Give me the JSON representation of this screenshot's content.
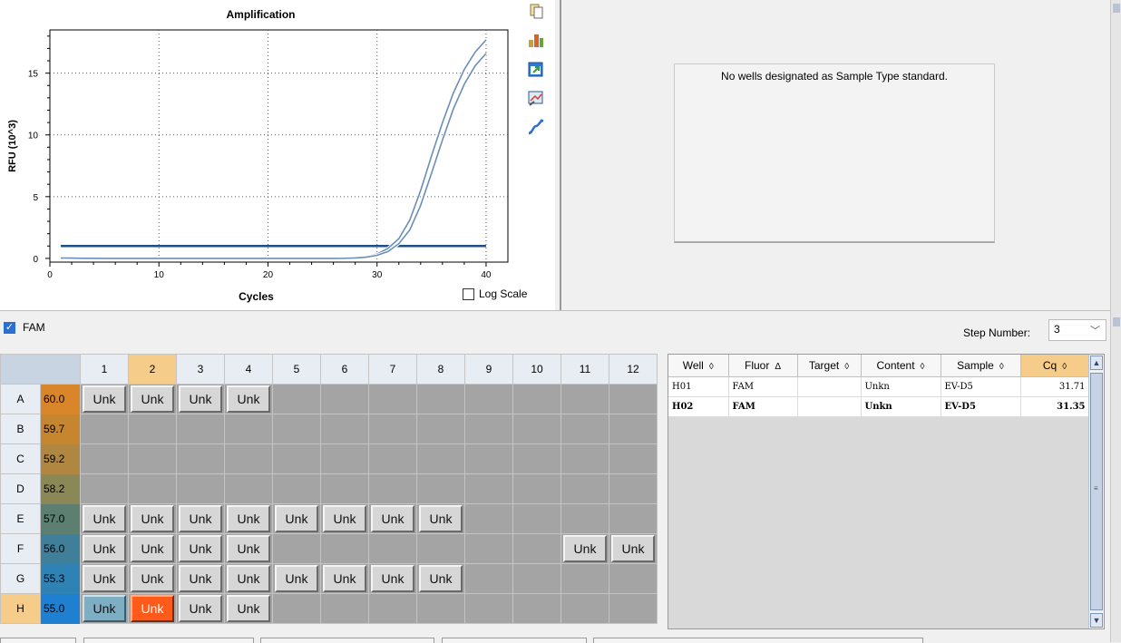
{
  "chart_data": {
    "type": "line",
    "title": "Amplification",
    "xlabel": "Cycles",
    "ylabel": "RFU (10^3)",
    "xlim": [
      0,
      42
    ],
    "ylim": [
      -0.3,
      18.5
    ],
    "xticks": [
      0,
      10,
      20,
      30,
      40
    ],
    "yticks": [
      0,
      5,
      10,
      15
    ],
    "grid": true,
    "series": [
      {
        "x": [
          1,
          2,
          3,
          4,
          5,
          6,
          7,
          8,
          9,
          10,
          11,
          12,
          13,
          14,
          15,
          16,
          17,
          18,
          19,
          20,
          21,
          22,
          23,
          24,
          25,
          26,
          27,
          28,
          29,
          30,
          31,
          32,
          33,
          34,
          35,
          36,
          37,
          38,
          39,
          40
        ],
        "values": [
          0.05,
          0.04,
          0.02,
          0.02,
          0.01,
          0.0,
          0.0,
          0.0,
          0.0,
          0.0,
          0.0,
          0.0,
          0.0,
          0.0,
          0.0,
          0.0,
          0.0,
          0.0,
          0.0,
          0.0,
          0.0,
          0.0,
          0.0,
          0.0,
          0.0,
          0.0,
          0.02,
          0.06,
          0.15,
          0.35,
          0.8,
          1.6,
          3.1,
          5.5,
          8.3,
          11.0,
          13.4,
          15.3,
          16.7,
          17.7
        ],
        "color": "#6a8eb8"
      },
      {
        "x": [
          1,
          2,
          3,
          4,
          5,
          6,
          7,
          8,
          9,
          10,
          11,
          12,
          13,
          14,
          15,
          16,
          17,
          18,
          19,
          20,
          21,
          22,
          23,
          24,
          25,
          26,
          27,
          28,
          29,
          30,
          31,
          32,
          33,
          34,
          35,
          36,
          37,
          38,
          39,
          40
        ],
        "values": [
          0.03,
          0.02,
          0.01,
          0.01,
          0.0,
          0.0,
          0.0,
          0.0,
          0.0,
          0.0,
          0.0,
          0.0,
          0.0,
          0.0,
          0.0,
          0.0,
          0.0,
          0.0,
          0.0,
          0.0,
          0.0,
          0.0,
          0.0,
          0.0,
          0.0,
          0.0,
          0.01,
          0.04,
          0.1,
          0.25,
          0.55,
          1.2,
          2.3,
          4.3,
          6.9,
          9.6,
          12.1,
          14.1,
          15.6,
          16.6
        ],
        "color": "#6a8eb8"
      }
    ],
    "threshold": {
      "x": [
        1,
        40
      ],
      "y": 1.0,
      "color": "#1e4f8c"
    }
  },
  "chart_options": {
    "log_scale_label": "Log Scale",
    "log_scale_checked": false
  },
  "chart_tools": [
    "copy-icon",
    "chart-settings-icon",
    "export-icon",
    "zoom-icon",
    "curve-icon"
  ],
  "standard_curve": {
    "message": "No wells designated as Sample Type standard."
  },
  "fluor_filter": {
    "label": "FAM",
    "checked": true
  },
  "step": {
    "label": "Step Number:",
    "value": "3"
  },
  "plate": {
    "columns": [
      "1",
      "2",
      "3",
      "4",
      "5",
      "6",
      "7",
      "8",
      "9",
      "10",
      "11",
      "12"
    ],
    "active_column": "2",
    "active_row": "H",
    "rows": [
      {
        "row": "A",
        "temp": "60.0",
        "temp_color": "#d9862a",
        "wells": [
          "Unk",
          "Unk",
          "Unk",
          "Unk",
          "",
          "",
          "",
          "",
          "",
          "",
          "",
          ""
        ]
      },
      {
        "row": "B",
        "temp": "59.7",
        "temp_color": "#c6852f",
        "wells": [
          "",
          "",
          "",
          "",
          "",
          "",
          "",
          "",
          "",
          "",
          "",
          ""
        ]
      },
      {
        "row": "C",
        "temp": "59.2",
        "temp_color": "#b08740",
        "wells": [
          "",
          "",
          "",
          "",
          "",
          "",
          "",
          "",
          "",
          "",
          "",
          ""
        ]
      },
      {
        "row": "D",
        "temp": "58.2",
        "temp_color": "#8b8858",
        "wells": [
          "",
          "",
          "",
          "",
          "",
          "",
          "",
          "",
          "",
          "",
          "",
          ""
        ]
      },
      {
        "row": "E",
        "temp": "57.0",
        "temp_color": "#5c7f72",
        "wells": [
          "Unk",
          "Unk",
          "Unk",
          "Unk",
          "Unk",
          "Unk",
          "Unk",
          "Unk",
          "",
          "",
          "",
          ""
        ]
      },
      {
        "row": "F",
        "temp": "56.0",
        "temp_color": "#3f7f9a",
        "wells": [
          "Unk",
          "Unk",
          "Unk",
          "Unk",
          "",
          "",
          "",
          "",
          "",
          "",
          "Unk",
          "Unk"
        ]
      },
      {
        "row": "G",
        "temp": "55.3",
        "temp_color": "#2f82b4",
        "wells": [
          "Unk",
          "Unk",
          "Unk",
          "Unk",
          "Unk",
          "Unk",
          "Unk",
          "Unk",
          "",
          "",
          "",
          ""
        ]
      },
      {
        "row": "H",
        "temp": "55.0",
        "temp_color": "#1f7fd0",
        "wells": [
          "Unk",
          "Unk",
          "Unk",
          "Unk",
          "",
          "",
          "",
          "",
          "",
          "",
          "",
          ""
        ]
      }
    ],
    "selected_wells": [
      {
        "row": "H",
        "col": 1,
        "style": "sel1"
      },
      {
        "row": "H",
        "col": 2,
        "style": "sel2"
      }
    ]
  },
  "results": {
    "headers": [
      {
        "label": "Well",
        "sort": "◊"
      },
      {
        "label": "Fluor",
        "sort": "Δ"
      },
      {
        "label": "Target",
        "sort": "◊"
      },
      {
        "label": "Content",
        "sort": "◊"
      },
      {
        "label": "Sample",
        "sort": "◊"
      },
      {
        "label": "Cq",
        "sort": "◊"
      }
    ],
    "rows": [
      {
        "well": "H01",
        "fluor": "FAM",
        "target": "",
        "content": "Unkn",
        "sample": "EV-D5",
        "cq": "31.71",
        "bold": false
      },
      {
        "well": "H02",
        "fluor": "FAM",
        "target": "",
        "content": "Unkn",
        "sample": "EV-D5",
        "cq": "31.35",
        "bold": true
      }
    ]
  }
}
